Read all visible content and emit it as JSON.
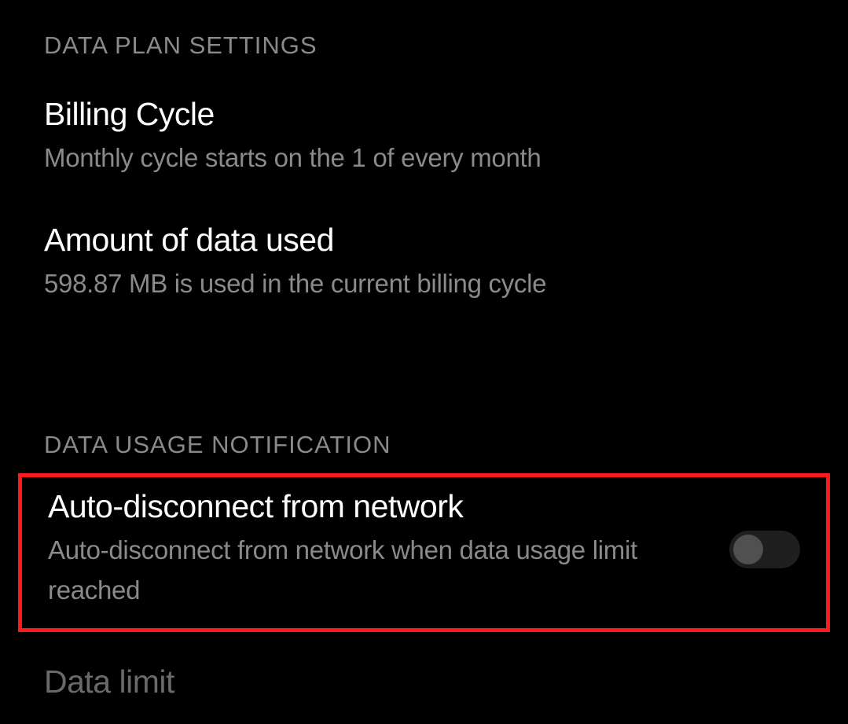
{
  "sections": {
    "plan_header": "DATA PLAN SETTINGS",
    "usage_header": "DATA USAGE NOTIFICATION"
  },
  "billing_cycle": {
    "title": "Billing Cycle",
    "subtitle": "Monthly cycle starts on the 1 of every month"
  },
  "amount_used": {
    "title": "Amount of data used",
    "subtitle": " 598.87 MB is used in the current billing cycle"
  },
  "auto_disconnect": {
    "title": "Auto-disconnect from network",
    "subtitle": "Auto-disconnect from network when data usage limit reached",
    "toggle": false
  },
  "data_limit": {
    "title": "Data limit"
  }
}
